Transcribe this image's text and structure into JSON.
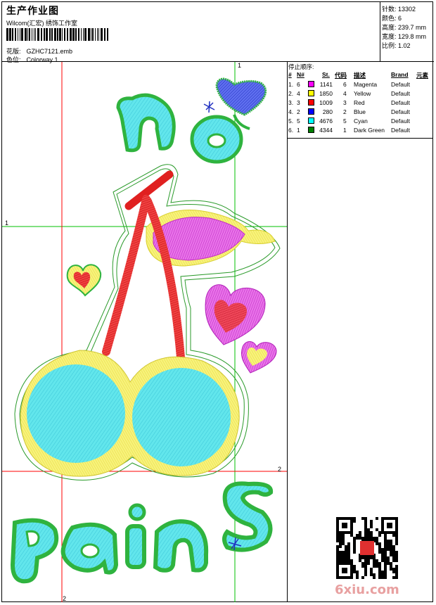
{
  "header": {
    "title": "生产作业图",
    "company": "Wilcom(汇宏) 绣饰工作室",
    "design_label": "花版:",
    "design_value": "GZHC7121.emb",
    "color_label": "色位:",
    "color_value": "Colorway 1"
  },
  "stats": [
    {
      "label": "针数:",
      "value": "13302"
    },
    {
      "label": "颜色:",
      "value": "6"
    },
    {
      "label": "高度:",
      "value": "239.7 mm"
    },
    {
      "label": "宽度:",
      "value": "129.8 mm"
    },
    {
      "label": "比例:",
      "value": "1.02"
    }
  ],
  "stop_sequence": {
    "title": "停止顺序:",
    "columns": [
      "#",
      "N#",
      "St.",
      "代码",
      "描述",
      "Brand",
      "元素"
    ],
    "rows": [
      {
        "idx": "1.",
        "n": "6",
        "color": "#ff00ff",
        "st": "1141",
        "code": "6",
        "desc": "Magenta",
        "brand": "Default"
      },
      {
        "idx": "2.",
        "n": "4",
        "color": "#ffff00",
        "st": "1850",
        "code": "4",
        "desc": "Yellow",
        "brand": "Default"
      },
      {
        "idx": "3.",
        "n": "3",
        "color": "#ff0000",
        "st": "1009",
        "code": "3",
        "desc": "Red",
        "brand": "Default"
      },
      {
        "idx": "4.",
        "n": "2",
        "color": "#0000ff",
        "st": "280",
        "code": "2",
        "desc": "Blue",
        "brand": "Default"
      },
      {
        "idx": "5.",
        "n": "5",
        "color": "#00ffff",
        "st": "4676",
        "code": "5",
        "desc": "Cyan",
        "brand": "Default"
      },
      {
        "idx": "6.",
        "n": "1",
        "color": "#008000",
        "st": "4344",
        "code": "1",
        "desc": "Dark Green",
        "brand": "Default"
      }
    ]
  },
  "canvas": {
    "guide_labels": {
      "v1": "1",
      "h1": "1",
      "v2": "2",
      "h2": "2"
    }
  },
  "watermark": "6xiu.com",
  "colors": {
    "cyan": "#5fe8ee",
    "green": "#2fb33f",
    "yellow": "#f5f07a",
    "magenta": "#e040e8",
    "red": "#e82020",
    "blue": "#3040d0",
    "guide_red": "#ff0000",
    "guide_green": "#00c000"
  }
}
